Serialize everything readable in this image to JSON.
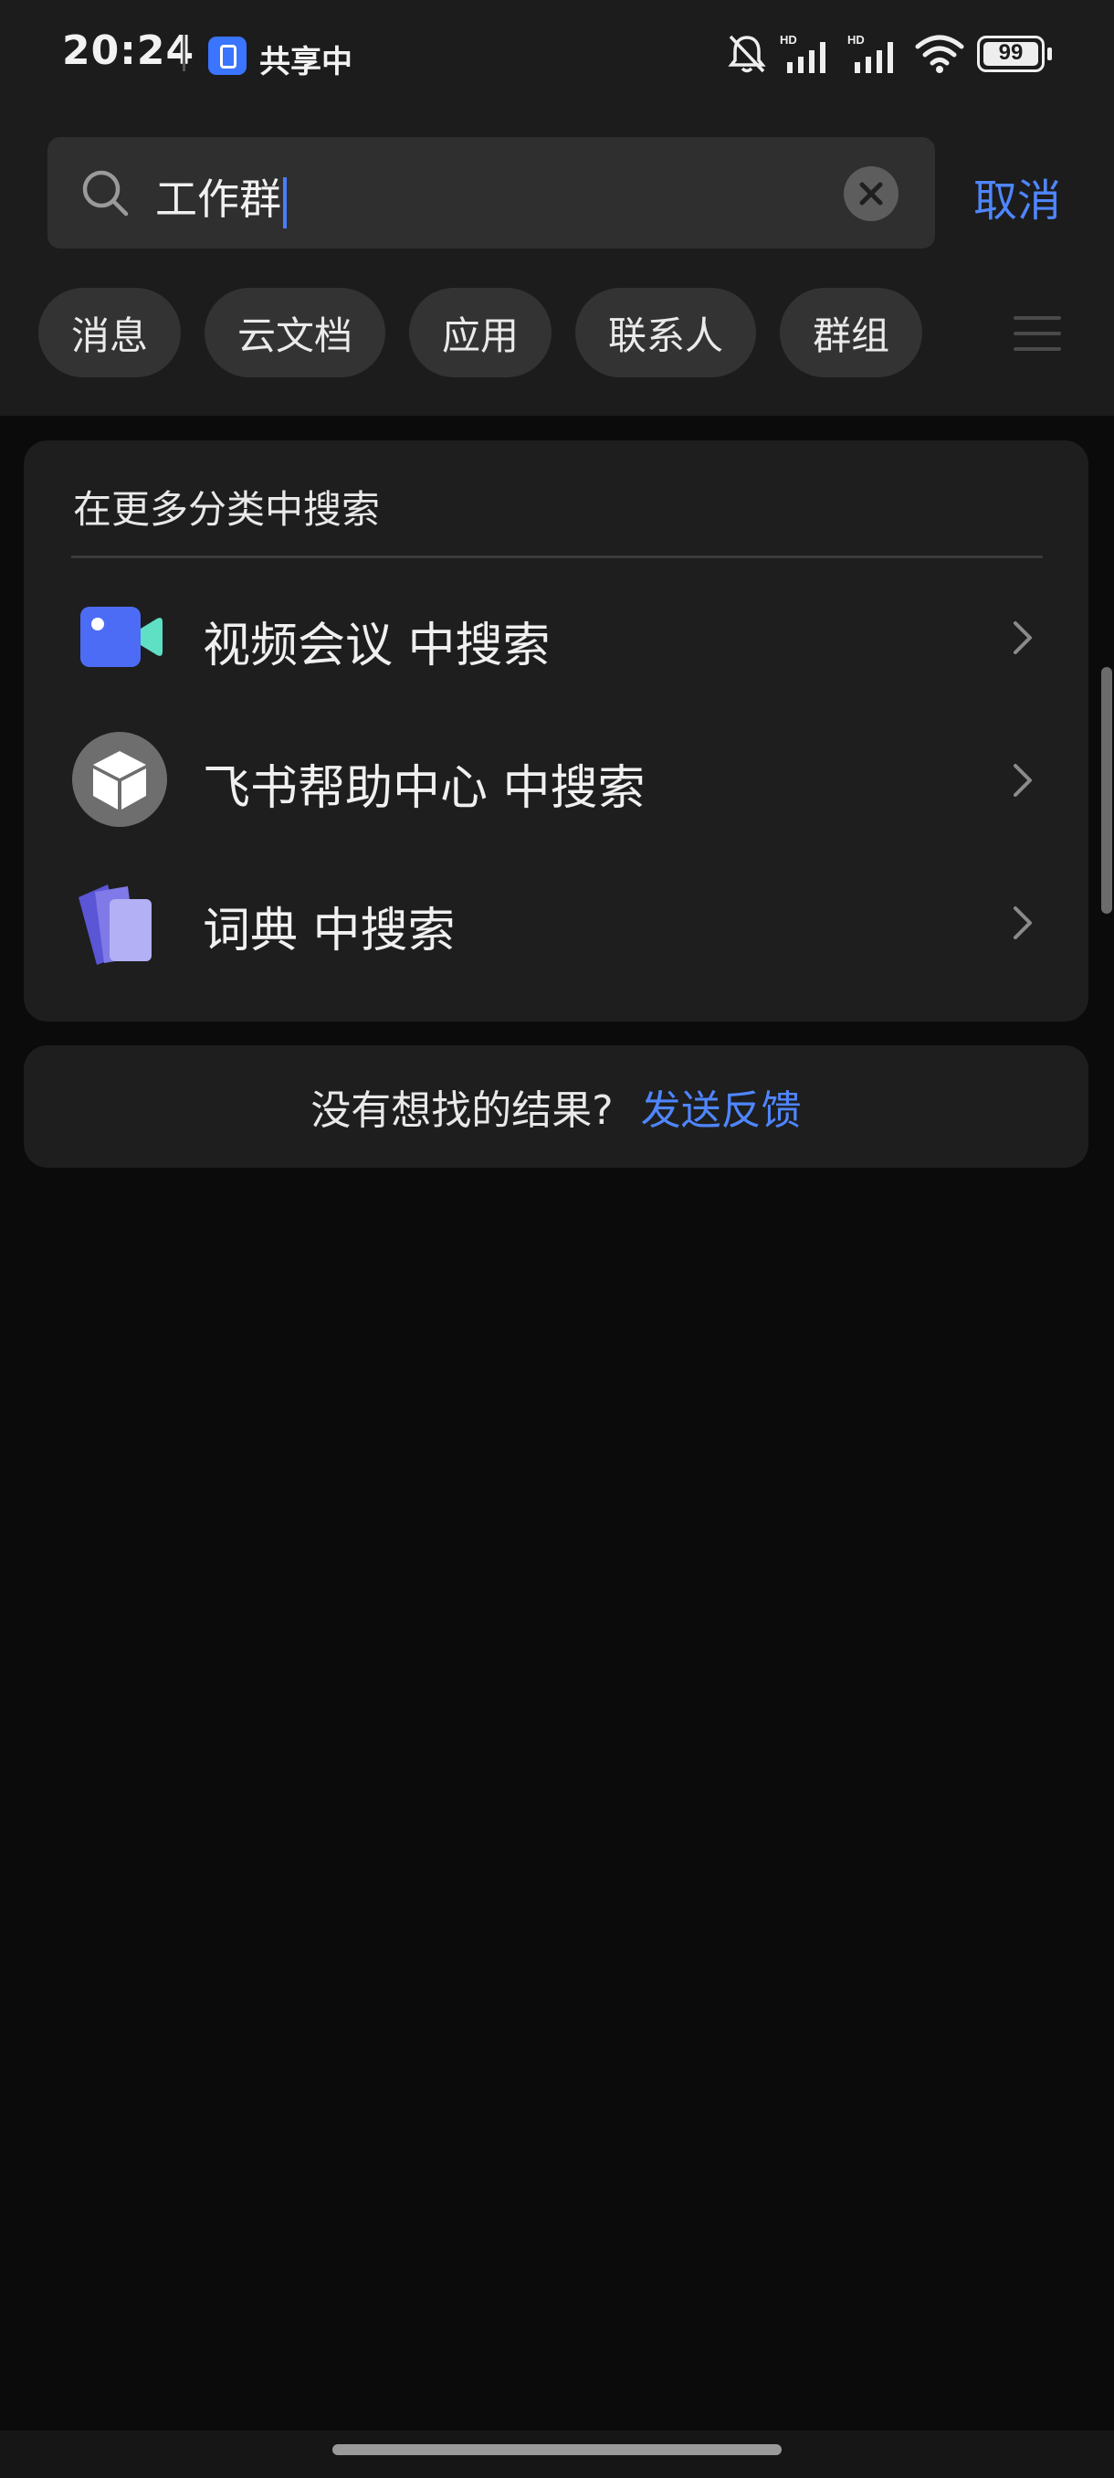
{
  "status_bar": {
    "time": "20:24",
    "sharing_label": "共享中",
    "battery": "99",
    "icons": [
      "screen-share-icon",
      "bell-off-icon",
      "signal-hd-icon",
      "signal-hd-icon",
      "wifi-icon",
      "battery-icon"
    ]
  },
  "search": {
    "query": "工作群",
    "clear_icon": "clear-icon",
    "cancel_label": "取消"
  },
  "tabs": [
    "消息",
    "云文档",
    "应用",
    "联系人",
    "群组"
  ],
  "more_categories": {
    "title": "在更多分类中搜索",
    "items": [
      {
        "label": "视频会议 中搜索",
        "icon": "video-meeting-icon"
      },
      {
        "label": "飞书帮助中心 中搜索",
        "icon": "help-center-icon"
      },
      {
        "label": "词典 中搜索",
        "icon": "dictionary-icon"
      }
    ]
  },
  "feedback": {
    "question": "没有想找的结果?",
    "link": "发送反馈"
  },
  "colors": {
    "accent": "#4f86ff",
    "header_bg": "#1c1c1c",
    "page_bg": "#0b0b0b",
    "card_bg": "#1e1e1e"
  }
}
